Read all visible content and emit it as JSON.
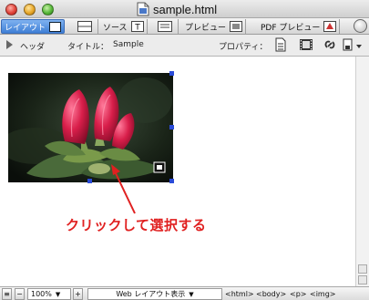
{
  "window": {
    "title": "sample.html"
  },
  "tabs": [
    {
      "label": "レイアウト",
      "icon": "layout-icon",
      "active": true
    },
    {
      "label": "",
      "icon": "split-view-icon",
      "active": false
    },
    {
      "label": "ソース",
      "icon": "source-icon",
      "active": false
    },
    {
      "label": "",
      "icon": "source-split-icon",
      "active": false
    },
    {
      "label": "プレビュー",
      "icon": "preview-icon",
      "active": false
    },
    {
      "label": "PDF プレビュー",
      "icon": "pdf-icon",
      "active": false
    }
  ],
  "toolbar": {
    "header_label": "ヘッダ",
    "title_label": "タイトル：",
    "title_value": "Sample",
    "properties_label": "プロパティ："
  },
  "annotation": {
    "text": "クリックして選択する",
    "color": "#e02020"
  },
  "statusbar": {
    "zoom": "100%",
    "view_mode": "Web レイアウト表示",
    "breadcrumb": [
      "<html>",
      "<body>",
      "<p>",
      "<img>"
    ]
  },
  "colors": {
    "active_tab": "#3f7fd6",
    "selection_handle": "#2a4bd8"
  }
}
